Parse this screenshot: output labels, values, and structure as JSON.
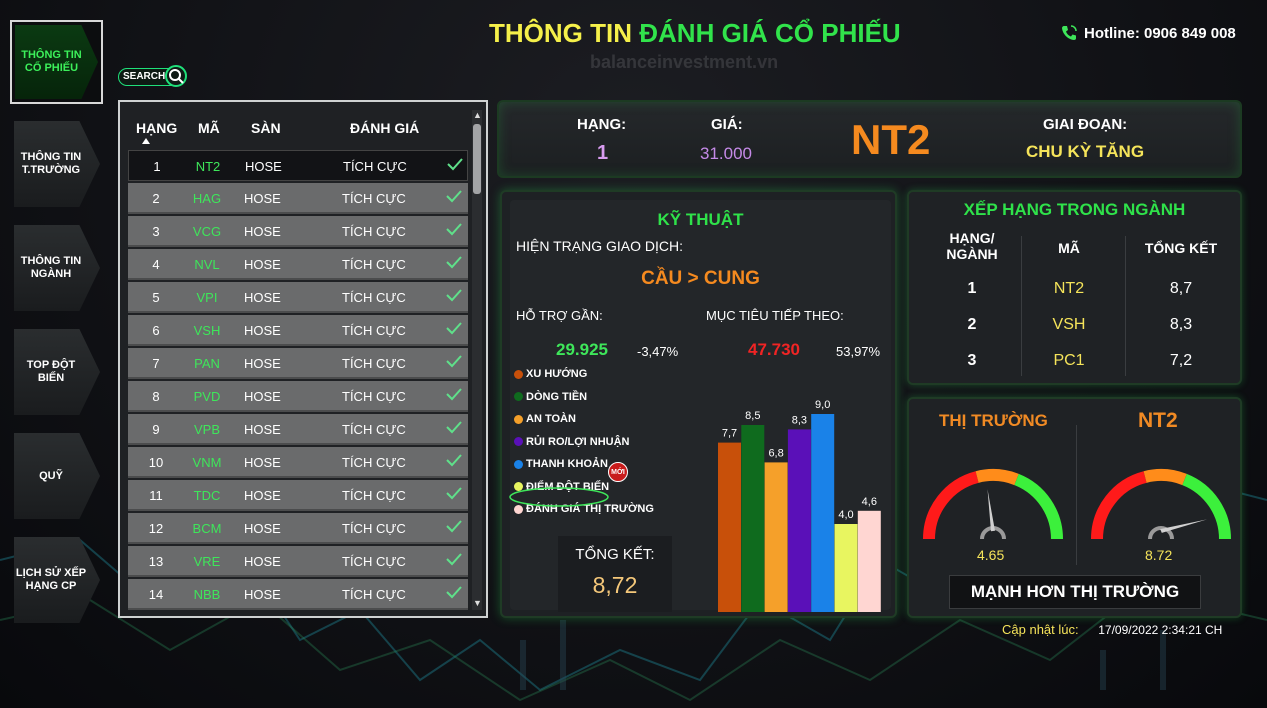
{
  "header": {
    "title_part1": "THÔNG TIN",
    "title_part2": "ĐÁNH GIÁ CỔ PHIẾU",
    "watermark": "balanceinvestment.vn",
    "hotline": "Hotline: 0906 849 008"
  },
  "sidebar": {
    "items": [
      {
        "label": "THÔNG TIN CỔ PHIẾU",
        "active": true
      },
      {
        "label": "THÔNG TIN T.TRƯỜNG"
      },
      {
        "label": "THÔNG TIN NGÀNH"
      },
      {
        "label": "TOP ĐỘT BIẾN"
      },
      {
        "label": "QUỸ"
      },
      {
        "label": "LỊCH SỬ XẾP HẠNG CP"
      }
    ]
  },
  "search": {
    "label": "SEARCH"
  },
  "table": {
    "columns": [
      "HẠNG",
      "MÃ",
      "SÀN",
      "ĐÁNH GIÁ"
    ],
    "rows": [
      {
        "rank": "1",
        "code": "NT2",
        "exchange": "HOSE",
        "rating": "TÍCH CỰC"
      },
      {
        "rank": "2",
        "code": "HAG",
        "exchange": "HOSE",
        "rating": "TÍCH CỰC"
      },
      {
        "rank": "3",
        "code": "VCG",
        "exchange": "HOSE",
        "rating": "TÍCH CỰC"
      },
      {
        "rank": "4",
        "code": "NVL",
        "exchange": "HOSE",
        "rating": "TÍCH CỰC"
      },
      {
        "rank": "5",
        "code": "VPI",
        "exchange": "HOSE",
        "rating": "TÍCH CỰC"
      },
      {
        "rank": "6",
        "code": "VSH",
        "exchange": "HOSE",
        "rating": "TÍCH CỰC"
      },
      {
        "rank": "7",
        "code": "PAN",
        "exchange": "HOSE",
        "rating": "TÍCH CỰC"
      },
      {
        "rank": "8",
        "code": "PVD",
        "exchange": "HOSE",
        "rating": "TÍCH CỰC"
      },
      {
        "rank": "9",
        "code": "VPB",
        "exchange": "HOSE",
        "rating": "TÍCH CỰC"
      },
      {
        "rank": "10",
        "code": "VNM",
        "exchange": "HOSE",
        "rating": "TÍCH CỰC"
      },
      {
        "rank": "11",
        "code": "TDC",
        "exchange": "HOSE",
        "rating": "TÍCH CỰC"
      },
      {
        "rank": "12",
        "code": "BCM",
        "exchange": "HOSE",
        "rating": "TÍCH CỰC"
      },
      {
        "rank": "13",
        "code": "VRE",
        "exchange": "HOSE",
        "rating": "TÍCH CỰC"
      },
      {
        "rank": "14",
        "code": "NBB",
        "exchange": "HOSE",
        "rating": "TÍCH CỰC"
      }
    ]
  },
  "summary": {
    "rank_label": "HẠNG:",
    "rank_value": "1",
    "price_label": "GIÁ:",
    "price_value": "31.000",
    "ticker": "NT2",
    "phase_label": "GIAI ĐOẠN:",
    "phase_value": "CHU KỲ TĂNG"
  },
  "technical": {
    "title": "KỸ THUẬT",
    "status_label": "HIỆN TRẠNG GIAO DỊCH:",
    "status_value": "CẦU > CUNG",
    "support_label": "HỖ TRỢ GẦN:",
    "support_value": "29.925",
    "support_pct": "-3,47%",
    "target_label": "MỤC TIÊU TIẾP THEO:",
    "target_value": "47.730",
    "target_pct": "53,97%",
    "new_badge": "MỚI",
    "total_label": "TỔNG KẾT:",
    "total_value": "8,72"
  },
  "chart_data": {
    "type": "bar",
    "categories": [
      "XU HƯỚNG",
      "DÒNG TIỀN",
      "AN TOÀN",
      "RỦI RO/LỢI NHUẬN",
      "THANH KHOẢN",
      "ĐIỂM ĐỘT BIẾN",
      "ĐÁNH GIÁ THỊ TRƯỜNG"
    ],
    "values": [
      7.7,
      8.5,
      6.8,
      8.3,
      9.0,
      4.0,
      4.6
    ],
    "value_labels": [
      "7,7",
      "8,5",
      "6,8",
      "8,3",
      "9,0",
      "4,0",
      "4,6"
    ],
    "colors": [
      "#c8500a",
      "#0f6b1e",
      "#f5a02a",
      "#5a10b8",
      "#1a82e8",
      "#e8f560",
      "#ffd6d2"
    ],
    "ylim": [
      0,
      10
    ],
    "grid": false,
    "legend": "left"
  },
  "sector": {
    "title": "XẾP HẠNG TRONG NGÀNH",
    "col_rank": "HẠNG/ NGÀNH",
    "col_code": "MÃ",
    "col_total": "TỔNG KẾT",
    "rows": [
      {
        "rank": "1",
        "code": "NT2",
        "total": "8,7"
      },
      {
        "rank": "2",
        "code": "VSH",
        "total": "8,3"
      },
      {
        "rank": "3",
        "code": "PC1",
        "total": "7,2"
      }
    ]
  },
  "gauges": {
    "market_label": "THỊ TRƯỜNG",
    "market_value": "4.65",
    "market_fraction": 0.465,
    "stock_label": "NT2",
    "stock_value": "8.72",
    "stock_fraction": 0.872,
    "verdict": "MẠNH HƠN THỊ TRƯỜNG"
  },
  "updated": {
    "label": "Cập nhật lúc:",
    "value": "17/09/2022 2:34:21 CH"
  }
}
